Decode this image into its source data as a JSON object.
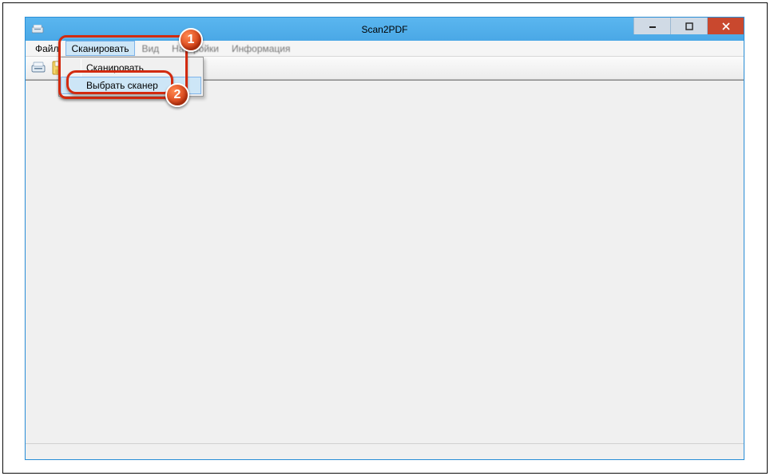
{
  "window": {
    "title": "Scan2PDF"
  },
  "menubar": {
    "file": "Файл",
    "scan": "Сканировать",
    "view": "Вид",
    "settings": "Настройки",
    "info": "Информация"
  },
  "dropdown": {
    "item1": "Сканировать",
    "item2": "Выбрать сканер"
  },
  "badges": {
    "one": "1",
    "two": "2"
  }
}
